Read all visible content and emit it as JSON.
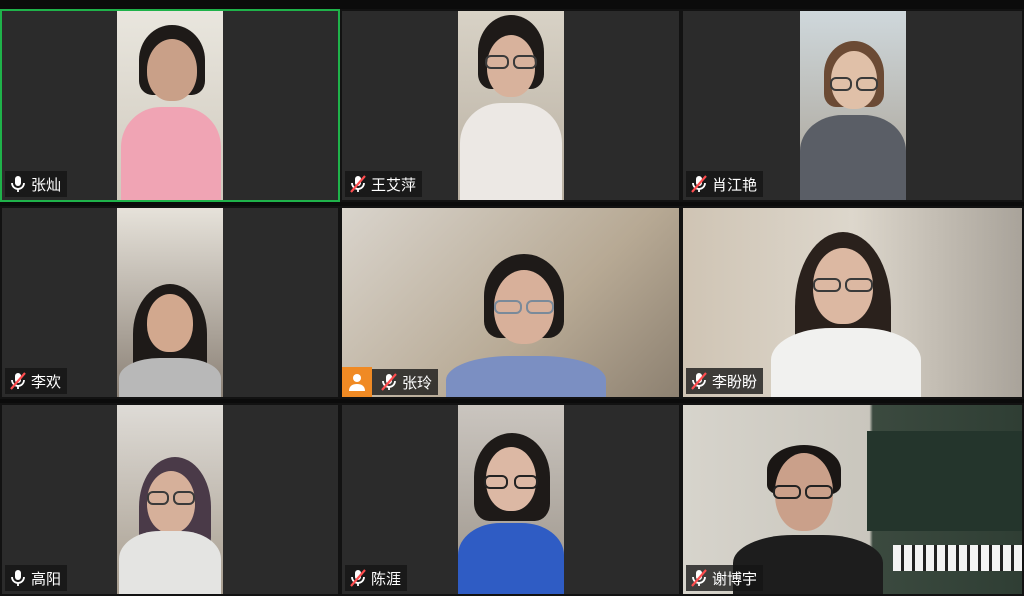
{
  "participants": [
    {
      "name": "张灿",
      "mic": "on",
      "active": true
    },
    {
      "name": "王艾萍",
      "mic": "muted",
      "active": false
    },
    {
      "name": "肖江艳",
      "mic": "muted",
      "active": false
    },
    {
      "name": "李欢",
      "mic": "muted",
      "active": false
    },
    {
      "name": "张玲",
      "mic": "muted",
      "active": false,
      "avatar": true
    },
    {
      "name": "李盼盼",
      "mic": "muted",
      "active": false
    },
    {
      "name": "高阳",
      "mic": "on",
      "active": false
    },
    {
      "name": "陈涯",
      "mic": "muted",
      "active": false
    },
    {
      "name": "谢博宇",
      "mic": "muted",
      "active": false
    }
  ],
  "colors": {
    "active_border": "#1fb24a",
    "muted_icon": "#ff4d4f",
    "avatar_bg": "#f08a24",
    "tile_bg": "#2b2b2b"
  }
}
